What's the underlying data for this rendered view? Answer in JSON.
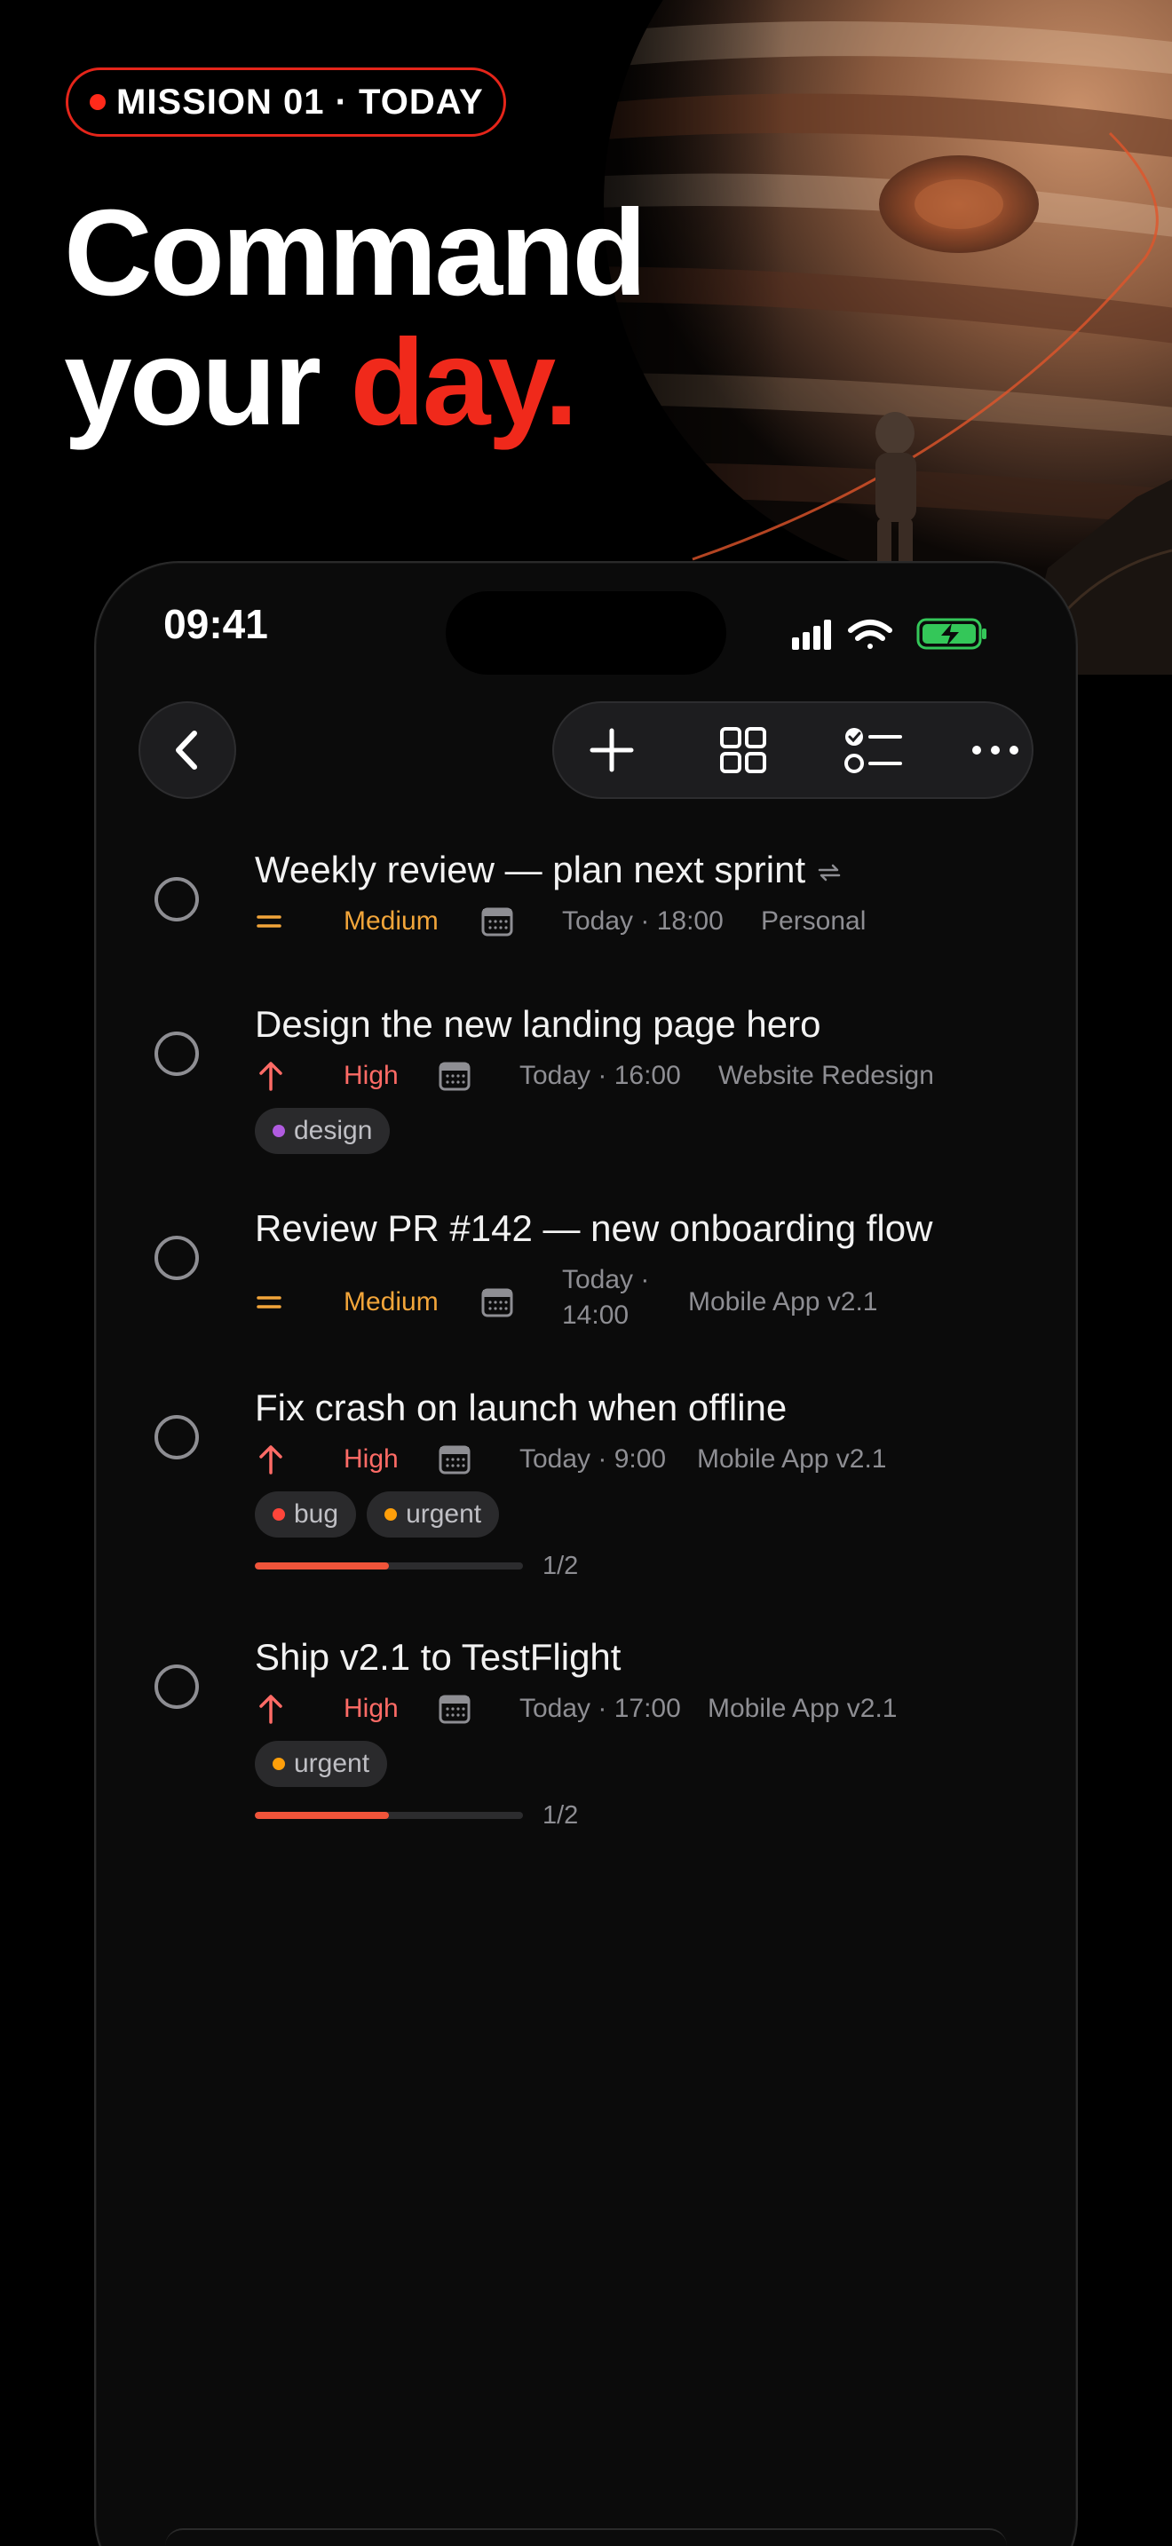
{
  "hero": {
    "badge": "MISSION 01 · TODAY",
    "headline_line1": "Command",
    "headline_line2_plain": "your ",
    "headline_line2_accent": "day."
  },
  "status_bar": {
    "time": "09:41",
    "icons": [
      "cellular-signal-icon",
      "wifi-icon",
      "battery-charging-icon"
    ],
    "battery_color": "#34c759"
  },
  "toolbar": {
    "back_icon": "chevron-left-icon",
    "actions": [
      "plus-icon",
      "grid-icon",
      "checklist-icon",
      "more-icon"
    ]
  },
  "colors": {
    "accent": "#f0291b",
    "medium": "#f2a53a",
    "high": "#ff6b66",
    "progress": "#f0543a",
    "tag_design": "#b05be0",
    "tag_bug": "#ff453a",
    "tag_urgent": "#ff9f0a"
  },
  "tasks": [
    {
      "title": "Weekly review — plan next sprint",
      "repeating": true,
      "priority": "Medium",
      "due": "Today · 18:00",
      "project": "Personal",
      "tags": [],
      "progress": null
    },
    {
      "title": "Design the new landing page hero",
      "repeating": false,
      "priority": "High",
      "due": "Today · 16:00",
      "project": "Website Redesign",
      "tags": [
        "design"
      ],
      "progress": null
    },
    {
      "title": "Review PR #142 — new onboarding flow",
      "repeating": false,
      "priority": "Medium",
      "due_line1": "Today ·",
      "due_line2": "14:00",
      "project": "Mobile App v2.1",
      "tags": [],
      "progress": null
    },
    {
      "title": "Fix crash on launch when offline",
      "repeating": false,
      "priority": "High",
      "due": "Today · 9:00",
      "project": "Mobile App v2.1",
      "tags": [
        "bug",
        "urgent"
      ],
      "progress": {
        "label": "1/2",
        "fraction": 0.5
      }
    },
    {
      "title": "Ship v2.1 to TestFlight",
      "repeating": false,
      "priority": "High",
      "due": "Today · 17:00",
      "project": "Mobile App v2.1",
      "tags": [
        "urgent"
      ],
      "progress": {
        "label": "1/2",
        "fraction": 0.5
      }
    }
  ]
}
